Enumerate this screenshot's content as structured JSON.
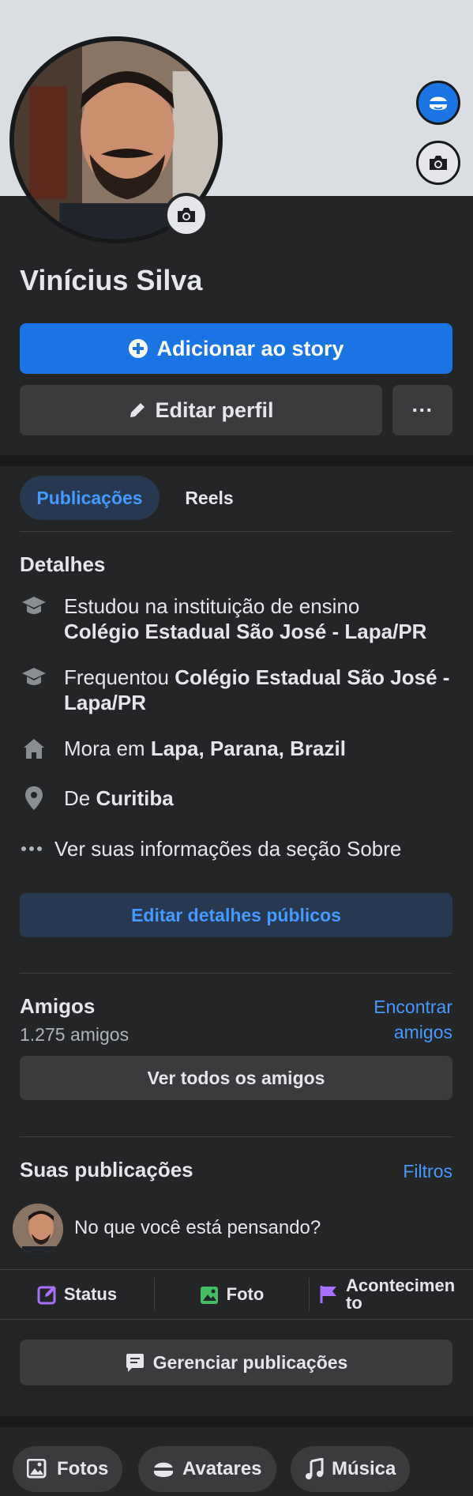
{
  "profile": {
    "name": "Vinícius Silva"
  },
  "buttons": {
    "add_story": "Adicionar ao story",
    "edit_profile": "Editar perfil",
    "more": "···"
  },
  "tabs": [
    {
      "label": "Publicações",
      "active": true
    },
    {
      "label": "Reels",
      "active": false
    }
  ],
  "details": {
    "title": "Detalhes",
    "items": [
      {
        "icon": "graduation-cap-icon",
        "prefix": "Estudou na instituição de ensino",
        "bold": "Colégio Estadual São José - Lapa/PR"
      },
      {
        "icon": "graduation-cap-icon",
        "prefix": "Frequentou",
        "bold": "Colégio Estadual São José - Lapa/PR"
      },
      {
        "icon": "home-icon",
        "prefix": "Mora em",
        "bold": "Lapa, Parana, Brazil"
      },
      {
        "icon": "location-pin-icon",
        "prefix": "De",
        "bold": "Curitiba"
      },
      {
        "icon": "more-dots-icon",
        "prefix": "Ver suas informações da seção Sobre",
        "bold": ""
      }
    ],
    "edit_public": "Editar detalhes públicos"
  },
  "friends": {
    "title": "Amigos",
    "count": "1.275 amigos",
    "find": "Encontrar amigos",
    "see_all": "Ver todos os amigos"
  },
  "posts": {
    "title": "Suas publicações",
    "filters": "Filtros",
    "composer_placeholder": "No que você está pensando?",
    "actions": [
      {
        "icon": "edit-status-icon",
        "label": "Status",
        "color": "#a970ff"
      },
      {
        "icon": "photo-icon",
        "label": "Foto",
        "color": "#45bd62"
      },
      {
        "icon": "flag-icon",
        "label": "Acontecimento",
        "color": "#a970ff"
      }
    ],
    "manage": "Gerenciar publicações"
  },
  "chips": [
    {
      "icon": "photos-icon",
      "label": "Fotos"
    },
    {
      "icon": "avatar-face-icon",
      "label": "Avatares"
    },
    {
      "icon": "music-note-icon",
      "label": "Música"
    }
  ],
  "colors": {
    "primary": "#1b74e4",
    "link": "#4599ff",
    "surface": "#242526",
    "button": "#3a3b3c"
  }
}
